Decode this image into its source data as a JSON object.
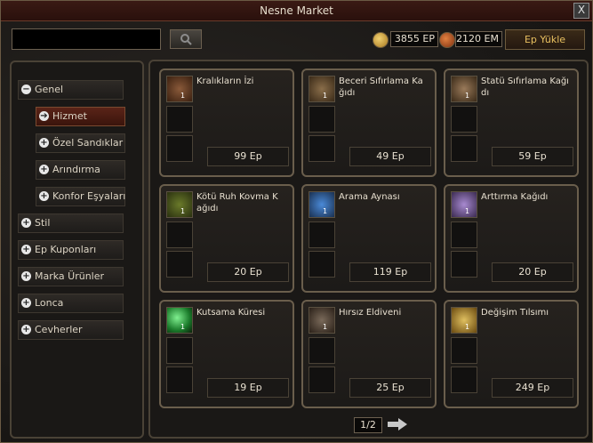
{
  "window": {
    "title": "Nesne Market",
    "close_label": "X"
  },
  "search": {
    "value": ""
  },
  "currency": {
    "ep": "3855 EP",
    "em": "2120 EM"
  },
  "load_button": "Ep Yükle",
  "sidebar": {
    "items": [
      {
        "label": "Genel",
        "sign": "−"
      },
      {
        "label": "Hizmet",
        "sign": "➔"
      },
      {
        "label": "Özel Sandıklar",
        "sign": "+"
      },
      {
        "label": "Arındırma",
        "sign": "+"
      },
      {
        "label": "Konfor Eşyaları",
        "sign": "+"
      },
      {
        "label": "Stil",
        "sign": "+"
      },
      {
        "label": "Ep Kuponları",
        "sign": "+"
      },
      {
        "label": "Marka Ürünler",
        "sign": "+"
      },
      {
        "label": "Lonca",
        "sign": "+"
      },
      {
        "label": "Cevherler",
        "sign": "+"
      }
    ]
  },
  "items": [
    {
      "name": "Kralıkların İzi",
      "price": "99 Ep",
      "qty": "1",
      "icon": "scroll-icon",
      "color": "#8a5a3a"
    },
    {
      "name": "Beceri Sıfırlama Ka ğıdı",
      "price": "49 Ep",
      "qty": "1",
      "icon": "paper-icon",
      "color": "#8a6e4a"
    },
    {
      "name": "Statü Sıfırlama Kağı dı",
      "price": "59 Ep",
      "qty": "1",
      "icon": "paper-icon",
      "color": "#9a7a5a"
    },
    {
      "name": "Kötü Ruh Kovma K ağıdı",
      "price": "20 Ep",
      "qty": "1",
      "icon": "charm-icon",
      "color": "#5a6a2a"
    },
    {
      "name": "Arama Aynası",
      "price": "119 Ep",
      "qty": "1",
      "icon": "mirror-icon",
      "color": "#3a6aa8"
    },
    {
      "name": "Arttırma Kağıdı",
      "price": "20 Ep",
      "qty": "1",
      "icon": "feather-icon",
      "color": "#8a6ab0"
    },
    {
      "name": "Kutsama Küresi",
      "price": "19 Ep",
      "qty": "1",
      "icon": "orb-icon",
      "color": "#2aa84a"
    },
    {
      "name": "Hırsız Eldiveni",
      "price": "25 Ep",
      "qty": "1",
      "icon": "glove-icon",
      "color": "#6a5a4a"
    },
    {
      "name": "Değişim Tılsımı",
      "price": "249 Ep",
      "qty": "1",
      "icon": "talisman-icon",
      "color": "#c8a040"
    }
  ],
  "pager": {
    "page": "1/2"
  }
}
